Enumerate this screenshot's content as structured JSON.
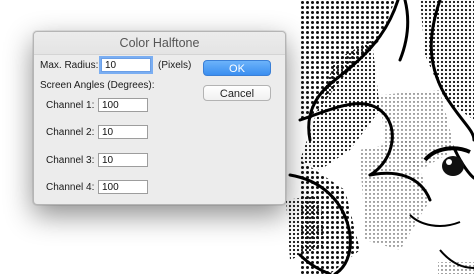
{
  "dialog": {
    "title": "Color Halftone",
    "max_radius": {
      "label": "Max. Radius:",
      "value": "10",
      "unit": "(Pixels)"
    },
    "screen_angles_label": "Screen Angles (Degrees):",
    "channels": [
      {
        "label": "Channel 1:",
        "value": "100"
      },
      {
        "label": "Channel 2:",
        "value": "10"
      },
      {
        "label": "Channel 3:",
        "value": "10"
      },
      {
        "label": "Channel 4:",
        "value": "100"
      }
    ],
    "ok_label": "OK",
    "cancel_label": "Cancel"
  },
  "colors": {
    "ok_accent": "#3a8ef0",
    "focus_ring": "#7aaef2"
  },
  "background": {
    "artwork": "halftone comic illustration"
  }
}
